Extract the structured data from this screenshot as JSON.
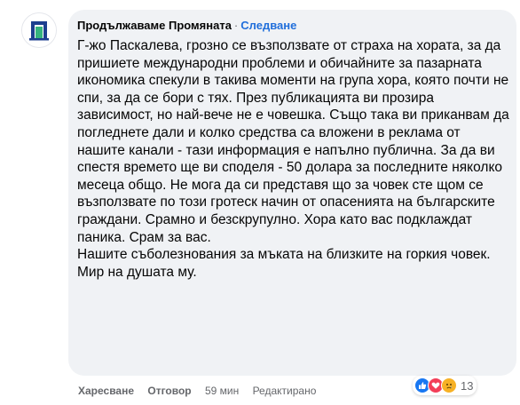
{
  "comment": {
    "author": "Продължаваме Промяната",
    "separator": "·",
    "follow_label": "Следване",
    "paragraphs": [
      "Г-жо Паскалева, грозно се възползвате от страха на хората, за да пришиете международни проблеми и обичайните за пазарната икономика спекули в такива моменти на група хора, която почти не спи, за да се бори с тях. През публикацията ви прозира зависимост, но най-вече не е човешка. Също така ви приканвам да погледнете дали и колко средства са вложени в реклама от нашите канали - тази информация е напълно публична. За да ви спестя времето ще ви споделя - 50 долара за последните няколко месеца общо. Не мога да си представя що за човек сте щом се възползвате по този гротеск начин от опасенията на българските граждани. Срамно и безскрупулно. Хора като вас подклаждат паника. Срам за вас.",
      "Нашите съболезнования за мъката на близките на горкия човек. Мир на душата му."
    ]
  },
  "actions": {
    "like_label": "Харесване",
    "reply_label": "Отговор",
    "time": "59 мин",
    "edited": "Редактирано"
  },
  "reactions": {
    "icons": [
      "like-icon",
      "love-icon",
      "sad-icon"
    ],
    "count": "13"
  },
  "colors": {
    "bubble": "#f0f2f5",
    "link": "#216fdb",
    "secondary_text": "#65676b",
    "like": "#1877f2",
    "love": "#f33e58",
    "sad": "#f7b125",
    "avatar_blue": "#1d3f8f",
    "avatar_green": "#36b37e"
  }
}
